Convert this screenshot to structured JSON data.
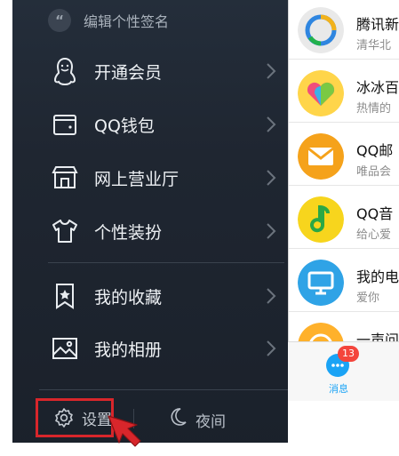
{
  "drawer": {
    "signature": {
      "quote_glyph": "“",
      "label": "编辑个性签名"
    },
    "menu_items": [
      {
        "label": "开通会员",
        "icon": "penguin-icon"
      },
      {
        "label": "QQ钱包",
        "icon": "wallet-icon"
      },
      {
        "label": "网上营业厅",
        "icon": "storefront-icon"
      },
      {
        "label": "个性装扮",
        "icon": "tshirt-icon"
      },
      {
        "label": "我的收藏",
        "icon": "bookmark-star-icon"
      },
      {
        "label": "我的相册",
        "icon": "photo-album-icon"
      }
    ],
    "bottom": {
      "settings_label": "设置",
      "night_label": "夜间"
    }
  },
  "messages": [
    {
      "title": "腾讯新",
      "preview": "清华北",
      "icon": "tencent-news-avatar"
    },
    {
      "title": "冰冰百",
      "preview": "热情的",
      "icon": "heart-app-avatar"
    },
    {
      "title": "QQ邮",
      "preview": "唯品会",
      "icon": "mail-avatar"
    },
    {
      "title": "QQ音",
      "preview": "给心爱",
      "icon": "music-note-avatar"
    },
    {
      "title": "我的电",
      "preview": "爱你",
      "icon": "computer-avatar"
    },
    {
      "title": "一声问",
      "preview": "",
      "icon": "chat-bubble-avatar"
    }
  ],
  "tab_bar": {
    "messages_label": "消息",
    "badge_count": "13"
  },
  "colors": {
    "drawer_bg": "#1f2631",
    "highlight": "#d8262b",
    "accent": "#1aa3f5"
  }
}
